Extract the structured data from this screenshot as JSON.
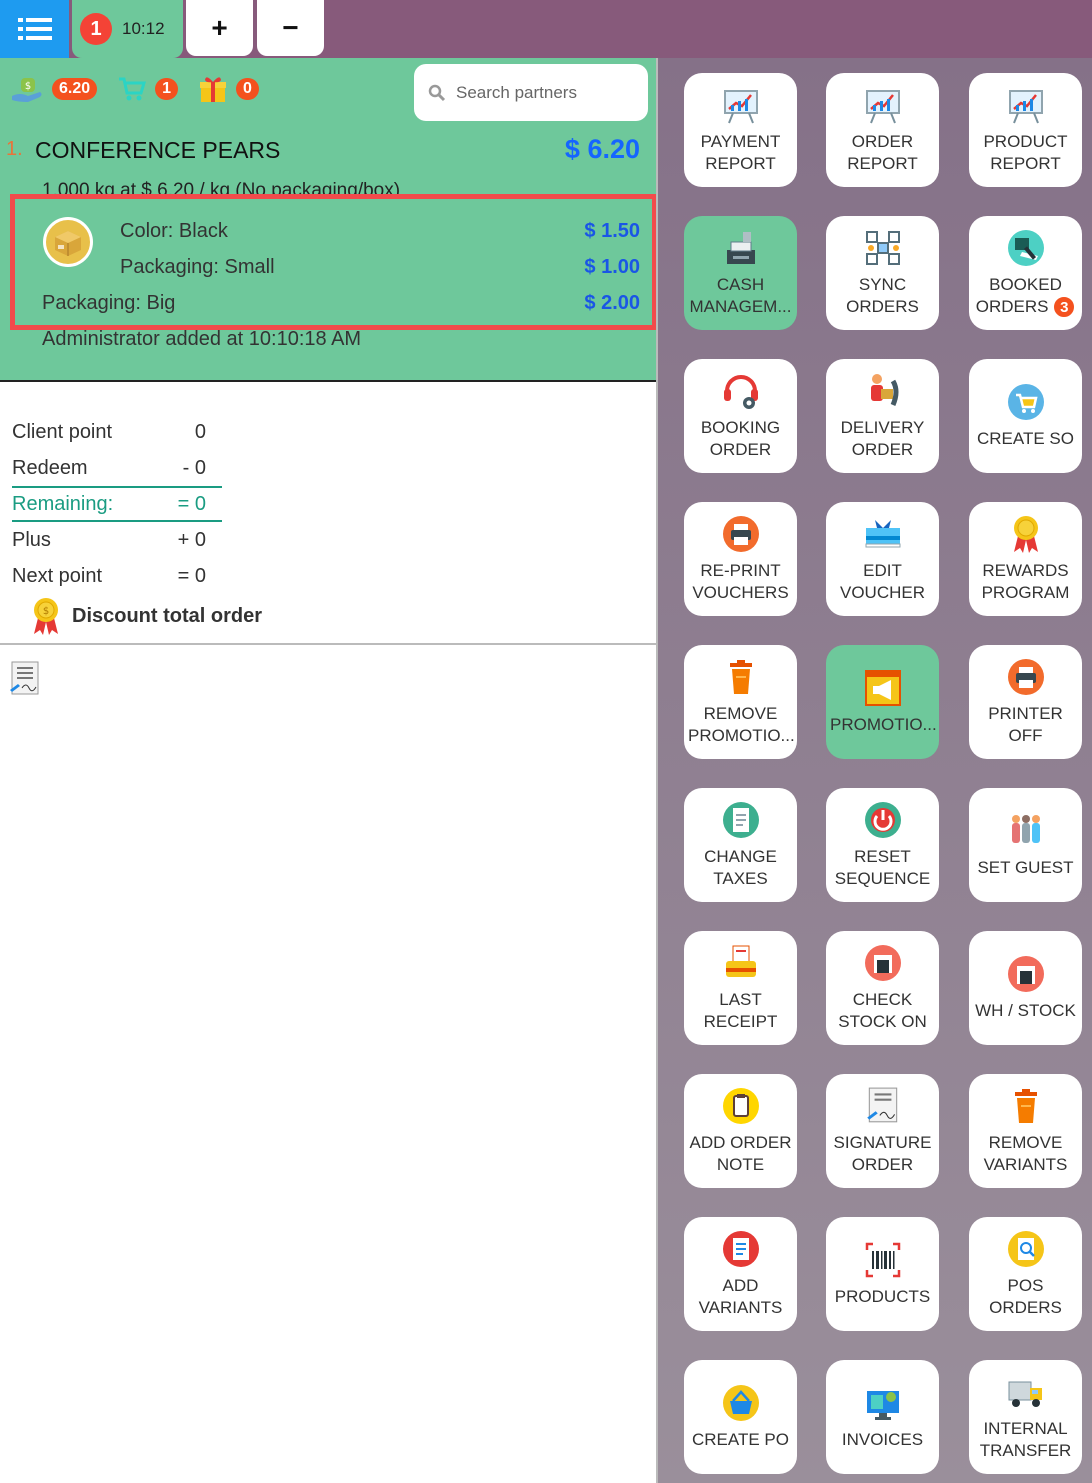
{
  "topbar": {
    "order_number": "1",
    "order_time": "10:12",
    "plus_label": "+",
    "minus_label": "−"
  },
  "summary": {
    "amount": "6.20",
    "cart_count": "1",
    "gift_count": "0"
  },
  "search": {
    "placeholder": "Search partners"
  },
  "order_line": {
    "index": "1.",
    "name": "CONFERENCE PEARS",
    "price": "$ 6.20",
    "detail": "1.000 kg at $ 6.20 / kg (No packaging/box)",
    "variants": [
      {
        "label": "Color: Black",
        "price": "$ 1.50"
      },
      {
        "label": "Packaging: Small",
        "price": "$ 1.00"
      },
      {
        "label": "Packaging: Big",
        "price": "$ 2.00"
      }
    ],
    "added_by": "Administrator added at 10:10:18 AM"
  },
  "points": {
    "rows": [
      {
        "label": "Client point",
        "value": "0"
      },
      {
        "label": "Redeem",
        "value": "- 0"
      },
      {
        "label": "Remaining:",
        "value": "= 0"
      },
      {
        "label": "Plus",
        "value": "+ 0"
      },
      {
        "label": "Next point",
        "value": "= 0"
      }
    ]
  },
  "discount": {
    "label": "Discount total order"
  },
  "tiles": [
    {
      "label": "PAYMENT\nREPORT",
      "icon": "chart-board-icon"
    },
    {
      "label": "ORDER\nREPORT",
      "icon": "chart-board-icon"
    },
    {
      "label": "PRODUCT\nREPORT",
      "icon": "chart-board-icon"
    },
    {
      "label": "CASH\nMANAGEM...",
      "icon": "cash-register-icon",
      "active": true
    },
    {
      "label": "SYNC\nORDERS",
      "icon": "sync-icon"
    },
    {
      "label": "BOOKED\nORDERS",
      "icon": "booked-icon",
      "badge": "3"
    },
    {
      "label": "BOOKING\nORDER",
      "icon": "headset-icon"
    },
    {
      "label": "DELIVERY\nORDER",
      "icon": "delivery-person-icon"
    },
    {
      "label": "CREATE SO",
      "icon": "cart-icon"
    },
    {
      "label": "RE-PRINT\nVOUCHERS",
      "icon": "printer-icon"
    },
    {
      "label": "EDIT\nVOUCHER",
      "icon": "voucher-icon"
    },
    {
      "label": "REWARDS\nPROGRAM",
      "icon": "medal-icon"
    },
    {
      "label": "REMOVE\nPROMOTIO...",
      "icon": "trash-icon"
    },
    {
      "label": "PROMOTIO...",
      "icon": "megaphone-icon",
      "active": true
    },
    {
      "label": "PRINTER\nOFF",
      "icon": "printer-icon"
    },
    {
      "label": "CHANGE\nTAXES",
      "icon": "tax-icon"
    },
    {
      "label": "RESET\nSEQUENCE",
      "icon": "power-icon"
    },
    {
      "label": "SET GUEST",
      "icon": "guests-icon"
    },
    {
      "label": "LAST\nRECEIPT",
      "icon": "receipt-icon"
    },
    {
      "label": "CHECK\nSTOCK ON",
      "icon": "warehouse-icon"
    },
    {
      "label": "WH / STOCK",
      "icon": "warehouse-icon"
    },
    {
      "label": "ADD ORDER\nNOTE",
      "icon": "clipboard-icon"
    },
    {
      "label": "SIGNATURE\nORDER",
      "icon": "signature-icon"
    },
    {
      "label": "REMOVE\nVARIANTS",
      "icon": "trash-icon"
    },
    {
      "label": "ADD\nVARIANTS",
      "icon": "checklist-icon"
    },
    {
      "label": "PRODUCTS",
      "icon": "barcode-icon"
    },
    {
      "label": "POS\nORDERS",
      "icon": "search-doc-icon"
    },
    {
      "label": "CREATE PO",
      "icon": "basket-icon"
    },
    {
      "label": "INVOICES",
      "icon": "invoice-screen-icon"
    },
    {
      "label": "INTERNAL\nTRANSFER",
      "icon": "truck-icon"
    }
  ],
  "colors": {
    "accent_green": "#6ec89b",
    "top_bar": "#875a7b",
    "menu_blue": "#1e9bf0",
    "price_blue": "#1565ff",
    "highlight_red": "#f24b4b",
    "badge_orange": "#f4511e"
  }
}
